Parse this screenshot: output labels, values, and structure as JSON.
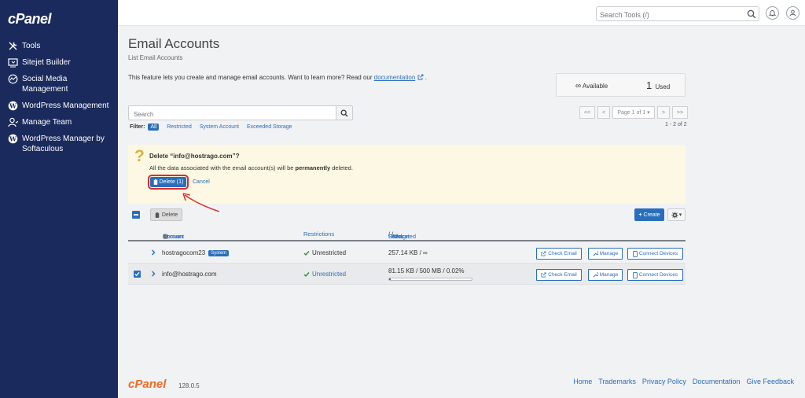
{
  "brand": {
    "logo": "cPanel",
    "version": "128.0.5"
  },
  "sidebar": {
    "items": [
      {
        "label": "Tools",
        "icon": "tools-icon"
      },
      {
        "label": "Sitejet Builder",
        "icon": "sitejet-icon"
      },
      {
        "label": "Social Media Management",
        "icon": "social-media-icon"
      },
      {
        "label": "WordPress Management",
        "icon": "wordpress-icon"
      },
      {
        "label": "Manage Team",
        "icon": "team-icon"
      },
      {
        "label": "WordPress Manager by Softaculous",
        "icon": "wordpress-icon"
      }
    ]
  },
  "topbar": {
    "search_placeholder": "Search Tools (/)"
  },
  "page": {
    "title": "Email Accounts",
    "subtitle": "List Email Accounts",
    "intro_text": "This feature lets you create and manage email accounts. Want to learn more? Read our",
    "intro_link": "documentation",
    "intro_end": "."
  },
  "stats": {
    "available_symbol": "∞",
    "available_label": "Available",
    "used_value": "1",
    "used_label": "Used"
  },
  "search": {
    "placeholder": "Search"
  },
  "filter": {
    "label": "Filter:",
    "options": [
      "All",
      "Restricted",
      "System Account",
      "Exceeded Storage"
    ],
    "active": "All"
  },
  "pagination": {
    "first": "<<",
    "prev": "<",
    "page_label": "Page 1 of 1",
    "next": ">",
    "last": ">>",
    "range": "1 - 2 of 2"
  },
  "confirm": {
    "title": "Delete “info@hostrago.com”?",
    "text_before": "All the data associated with the email account(s) will be",
    "text_bold": "permanently",
    "text_after": "deleted.",
    "delete_label": "Delete (1)",
    "cancel_label": "Cancel"
  },
  "toolbar": {
    "delete_label": "Delete",
    "create_label": "Create"
  },
  "table": {
    "headers": {
      "account": "Account",
      "at": "@",
      "domain": "Domain",
      "restrictions": "Restrictions",
      "storage_prefix": "Storage:",
      "used": "Used",
      "allocated": "Allocated",
      "percent": "%"
    },
    "actions": {
      "check_email": "Check Email",
      "manage": "Manage",
      "connect": "Connect Devices"
    },
    "rows": [
      {
        "account": "hostragocom23",
        "badge": "System",
        "restriction": "Unrestricted",
        "storage": "257.14 KB / ∞",
        "selected": false
      },
      {
        "account": "info@hostrago.com",
        "badge": "",
        "restriction": "Unrestricted",
        "storage": "81.15 KB / 500 MB / 0.02%",
        "usage_fraction": 0.02,
        "selected": true
      }
    ]
  },
  "footer": {
    "links": [
      "Home",
      "Trademarks",
      "Privacy Policy",
      "Documentation",
      "Give Feedback"
    ]
  },
  "colors": {
    "sidebar": "#1a2a5c",
    "accent": "#2a6ebb",
    "confirm_bg": "#fcf8e3",
    "highlight": "#d72c2c",
    "footer_logo": "#f06a28"
  }
}
